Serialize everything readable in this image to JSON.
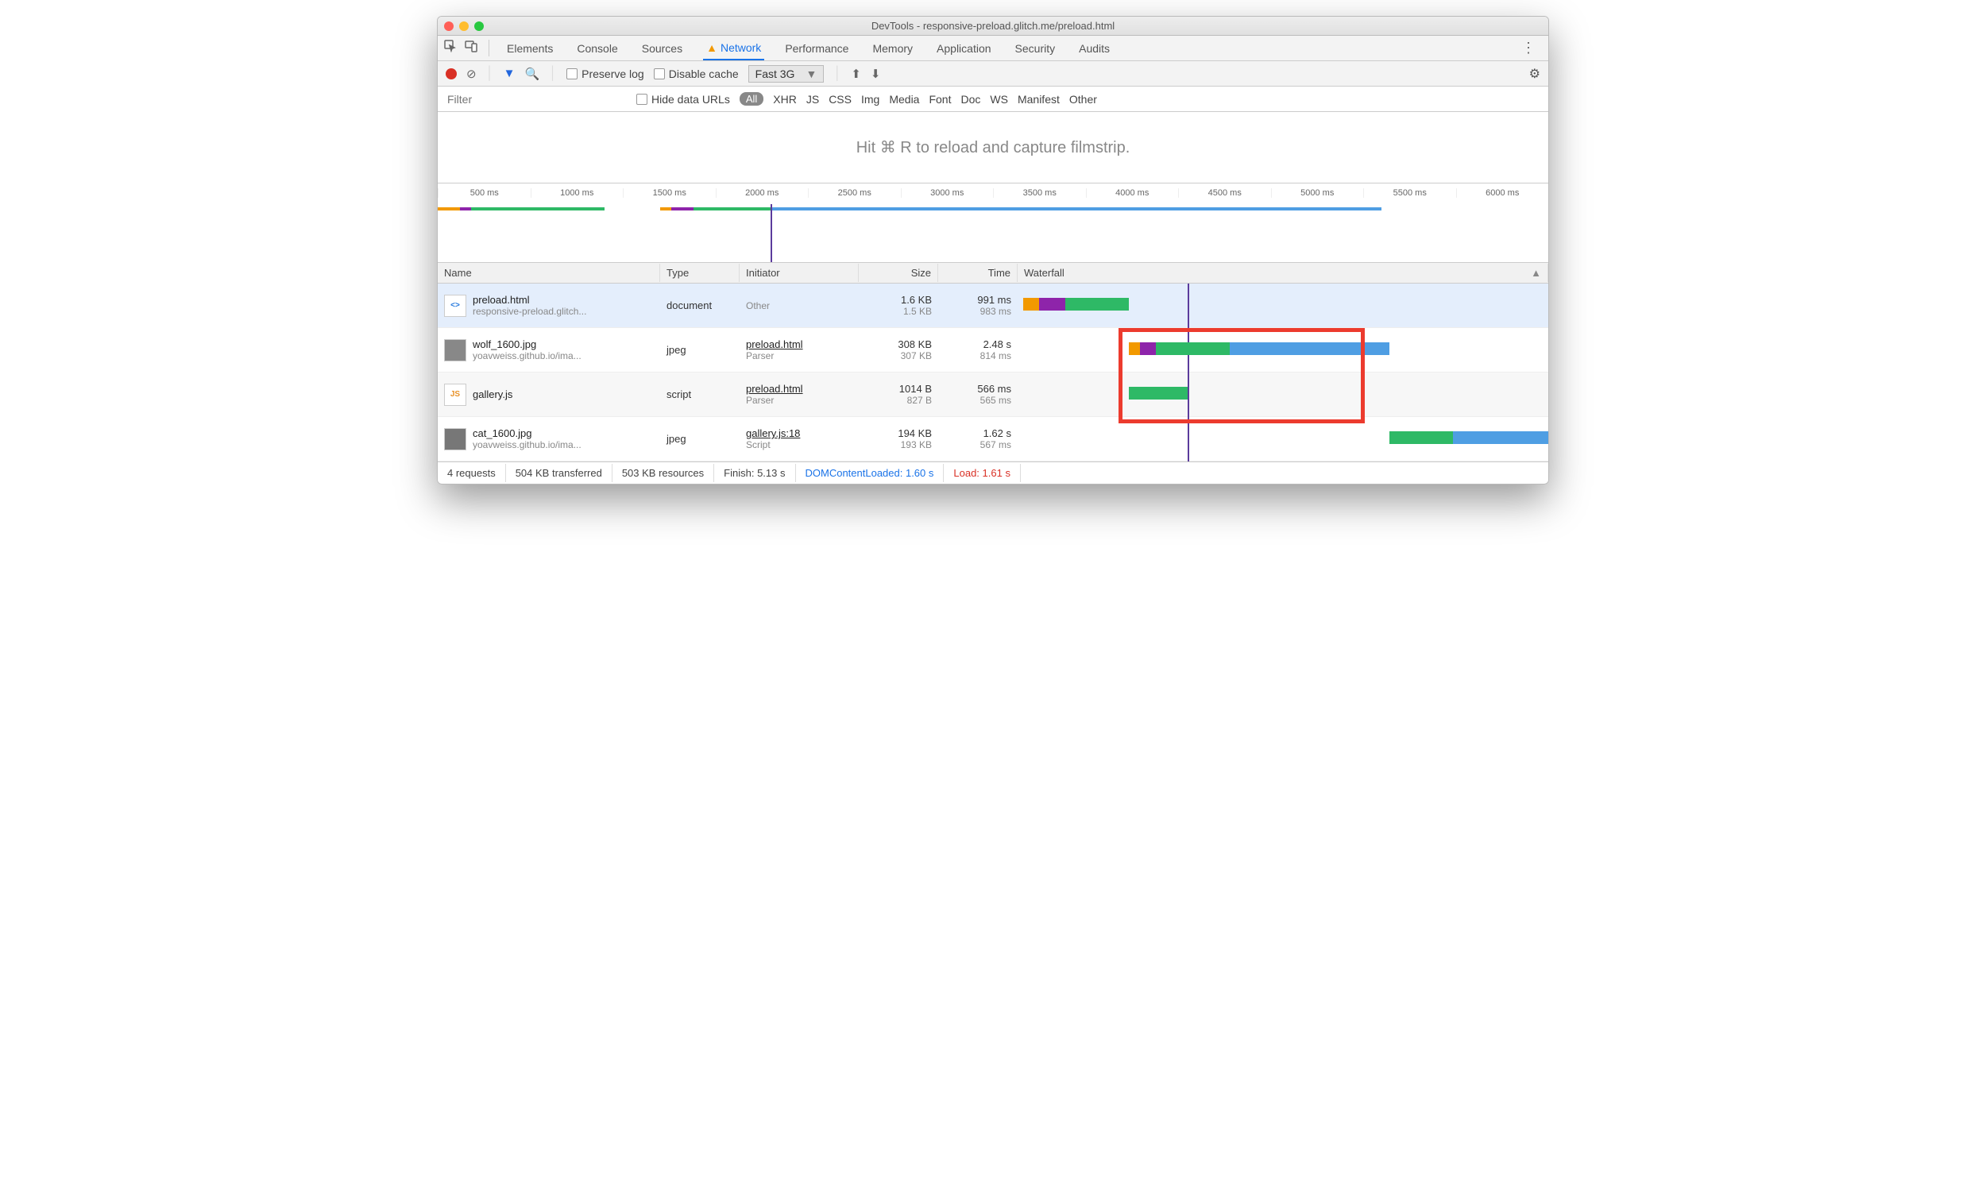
{
  "window": {
    "title": "DevTools - responsive-preload.glitch.me/preload.html"
  },
  "tabs": [
    "Elements",
    "Console",
    "Sources",
    "Network",
    "Performance",
    "Memory",
    "Application",
    "Security",
    "Audits"
  ],
  "activeTab": "Network",
  "toolbar": {
    "preserve": "Preserve log",
    "disable": "Disable cache",
    "throttle": "Fast 3G"
  },
  "filterbar": {
    "placeholder": "Filter",
    "hideData": "Hide data URLs",
    "all": "All",
    "types": [
      "XHR",
      "JS",
      "CSS",
      "Img",
      "Media",
      "Font",
      "Doc",
      "WS",
      "Manifest",
      "Other"
    ]
  },
  "captureHint": "Hit ⌘ R to reload and capture filmstrip.",
  "timelineTicks": [
    "500 ms",
    "1000 ms",
    "1500 ms",
    "2000 ms",
    "2500 ms",
    "3000 ms",
    "3500 ms",
    "4000 ms",
    "4500 ms",
    "5000 ms",
    "5500 ms",
    "6000 ms"
  ],
  "columns": {
    "name": "Name",
    "type": "Type",
    "initiator": "Initiator",
    "size": "Size",
    "time": "Time",
    "waterfall": "Waterfall"
  },
  "rows": [
    {
      "name": "preload.html",
      "host": "responsive-preload.glitch...",
      "type": "document",
      "initiator": "Other",
      "initiatorSub": "",
      "size": "1.6 KB",
      "sizeSub": "1.5 KB",
      "time": "991 ms",
      "timeSub": "983 ms"
    },
    {
      "name": "wolf_1600.jpg",
      "host": "yoavweiss.github.io/ima...",
      "type": "jpeg",
      "initiator": "preload.html",
      "initiatorSub": "Parser",
      "size": "308 KB",
      "sizeSub": "307 KB",
      "time": "2.48 s",
      "timeSub": "814 ms"
    },
    {
      "name": "gallery.js",
      "host": "",
      "type": "script",
      "initiator": "preload.html",
      "initiatorSub": "Parser",
      "size": "1014 B",
      "sizeSub": "827 B",
      "time": "566 ms",
      "timeSub": "565 ms"
    },
    {
      "name": "cat_1600.jpg",
      "host": "yoavweiss.github.io/ima...",
      "type": "jpeg",
      "initiator": "gallery.js:18",
      "initiatorSub": "Script",
      "size": "194 KB",
      "sizeSub": "193 KB",
      "time": "1.62 s",
      "timeSub": "567 ms"
    }
  ],
  "status": {
    "requests": "4 requests",
    "transferred": "504 KB transferred",
    "resources": "503 KB resources",
    "finish": "Finish: 5.13 s",
    "dcl": "DOMContentLoaded: 1.60 s",
    "load": "Load: 1.61 s"
  }
}
